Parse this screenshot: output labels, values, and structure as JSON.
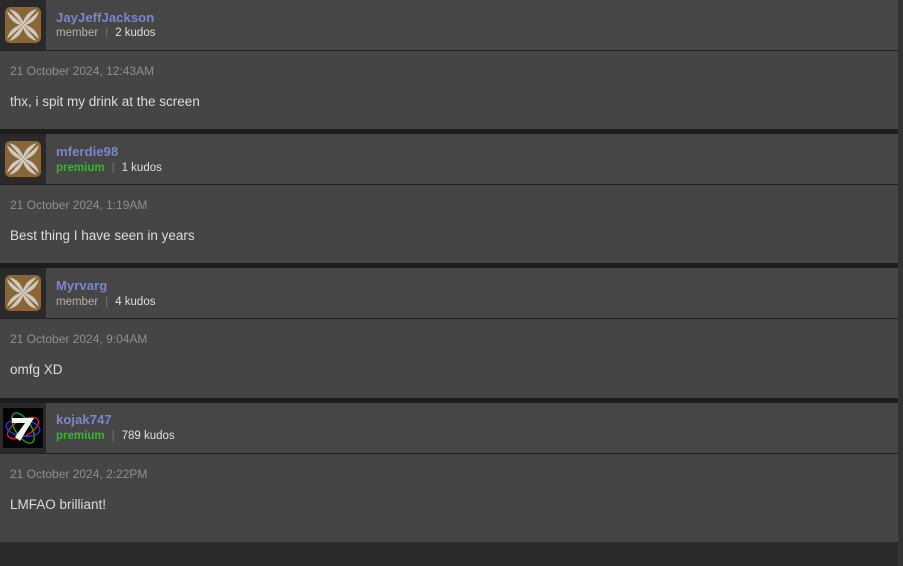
{
  "theme": {
    "page_background": "#2b2b2b",
    "header_background": "#464646",
    "body_background": "#454545",
    "avatar_cell_background": "#2a2a2a",
    "username_color": "#7b86d1",
    "premium_color": "#2fbb2f",
    "member_color": "#b9b0a4",
    "kudos_color": "#e2ded8",
    "timestamp_color": "#8e8e8e",
    "message_color": "#ddddd8",
    "separator_color": "#1d1d1d"
  },
  "comments": [
    {
      "username": "JayJeffJackson",
      "role": "member",
      "role_type": "member",
      "separator": "|",
      "kudos": "2 kudos",
      "timestamp": "21 October 2024, 12:43AM",
      "message": "thx, i spit my drink at the screen",
      "avatar": "default-pinwheel-avatar"
    },
    {
      "username": "mferdie98",
      "role": "premium",
      "role_type": "premium",
      "separator": "|",
      "kudos": "1 kudos",
      "timestamp": "21 October 2024, 1:19AM",
      "message": "Best thing I have seen in years",
      "avatar": "default-pinwheel-avatar"
    },
    {
      "username": "Myrvarg",
      "role": "member",
      "role_type": "member",
      "separator": "|",
      "kudos": "4 kudos",
      "timestamp": "21 October 2024, 9:04AM",
      "message": "omfg XD",
      "avatar": "default-pinwheel-avatar"
    },
    {
      "username": "kojak747",
      "role": "premium",
      "role_type": "premium",
      "separator": "|",
      "kudos": "789 kudos",
      "timestamp": "21 October 2024, 2:22PM",
      "message": "LMFAO brilliant!",
      "avatar": "atom-orbit-seven-avatar"
    }
  ]
}
